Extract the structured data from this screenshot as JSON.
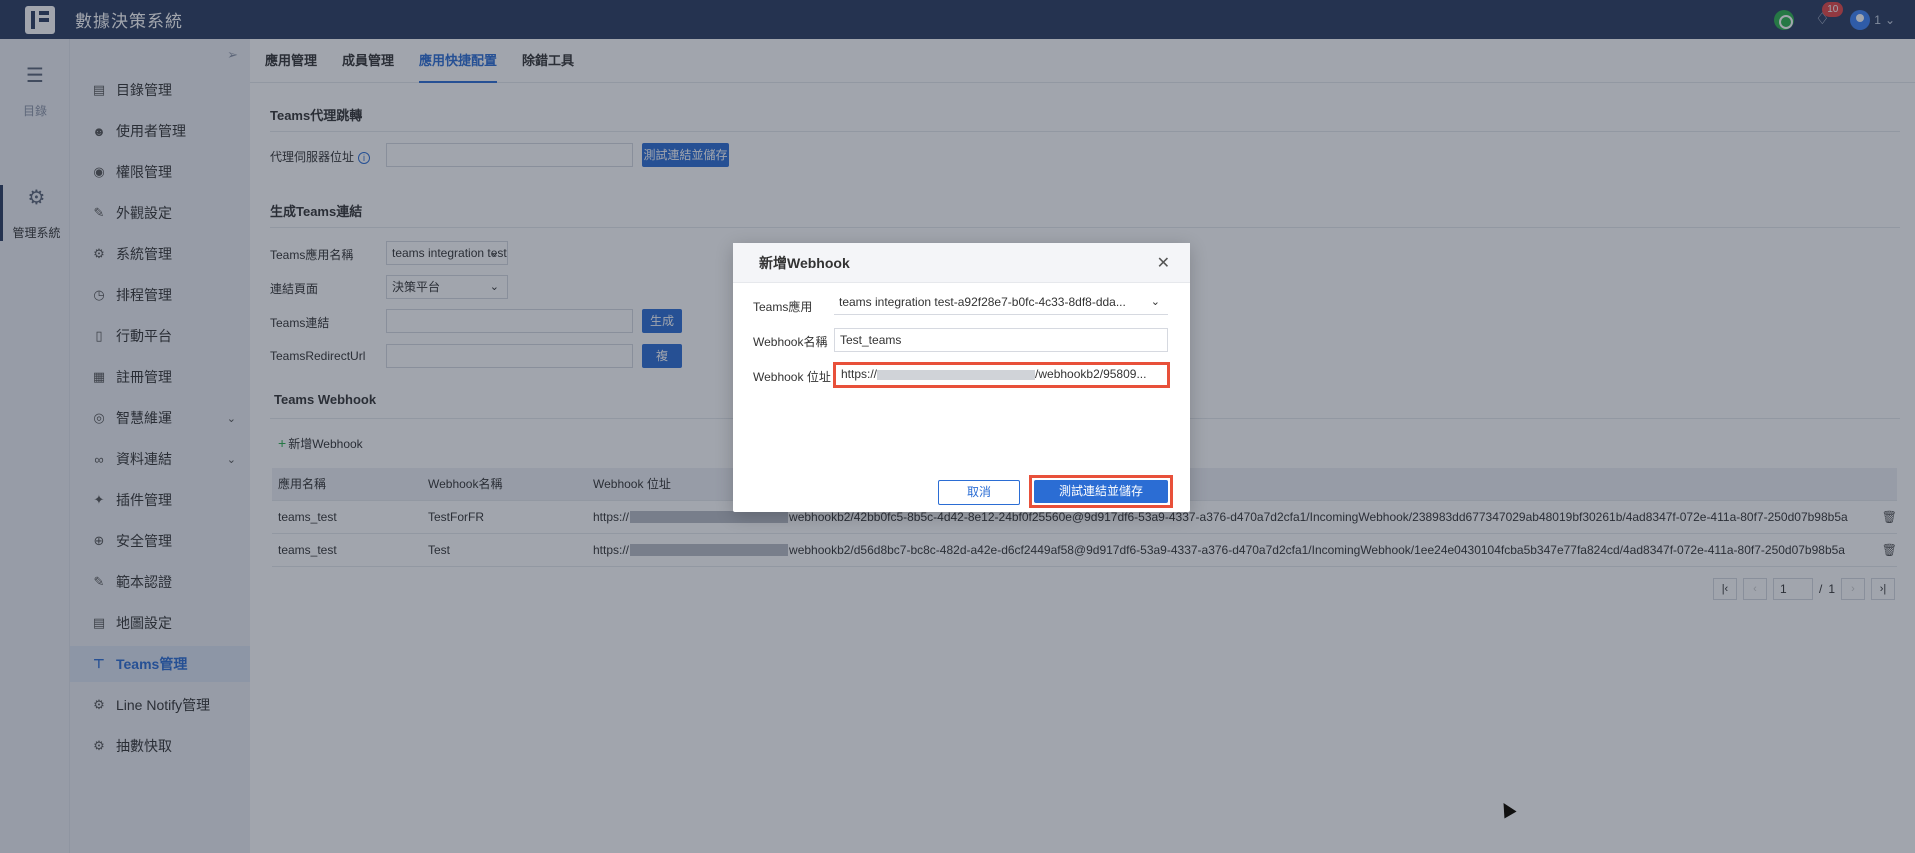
{
  "app": {
    "title": "數據決策系統"
  },
  "header": {
    "notification_count": "10",
    "user_label": "1"
  },
  "rail": {
    "catalog": "目錄",
    "admin": "管理系統"
  },
  "sidebar": {
    "items": [
      {
        "label": "目錄管理",
        "icon": "list-icon"
      },
      {
        "label": "使用者管理",
        "icon": "user-icon"
      },
      {
        "label": "權限管理",
        "icon": "shield-icon"
      },
      {
        "label": "外觀設定",
        "icon": "paint-icon"
      },
      {
        "label": "系統管理",
        "icon": "gear-icon"
      },
      {
        "label": "排程管理",
        "icon": "timer-icon"
      },
      {
        "label": "行動平台",
        "icon": "mobile-icon"
      },
      {
        "label": "註冊管理",
        "icon": "register-icon"
      },
      {
        "label": "智慧維運",
        "icon": "ops-icon"
      },
      {
        "label": "資料連結",
        "icon": "link-icon"
      },
      {
        "label": "插件管理",
        "icon": "plugin-icon"
      },
      {
        "label": "安全管理",
        "icon": "security-icon"
      },
      {
        "label": "範本認證",
        "icon": "template-icon"
      },
      {
        "label": "地圖設定",
        "icon": "map-icon"
      },
      {
        "label": "Teams管理",
        "icon": "teams-icon"
      },
      {
        "label": "Line Notify管理",
        "icon": "gear-icon"
      },
      {
        "label": "抽數快取",
        "icon": "gear-icon"
      }
    ]
  },
  "tabs": [
    "應用管理",
    "成員管理",
    "應用快捷配置",
    "除錯工具"
  ],
  "proxy": {
    "section_title": "Teams代理跳轉",
    "server_label": "代理伺服器位址",
    "test_button": "測試連結並儲存"
  },
  "generate": {
    "section_title": "生成Teams連結",
    "app_name_label": "Teams應用名稱",
    "app_name_value": "teams integration test",
    "link_page_label": "連結頁面",
    "link_page_value": "決策平台",
    "teams_link_label": "Teams連結",
    "redirect_label": "TeamsRedirectUrl",
    "generate_button": "生成",
    "copy_button": "複"
  },
  "webhook": {
    "section_title": "Teams Webhook",
    "add_label": "新增Webhook",
    "columns": [
      "應用名稱",
      "Webhook名稱",
      "Webhook 位址"
    ],
    "rows": [
      {
        "app": "teams_test",
        "name": "TestForFR",
        "url_prefix": "https://",
        "url_suffix": "webhookb2/42bb0fc5-8b5c-4d42-8e12-24bf0f25560e@9d917df6-53a9-4337-a376-d470a7d2cfa1/IncomingWebhook/238983dd677347029ab48019bf30261b/4ad8347f-072e-411a-80f7-250d07b98b5a"
      },
      {
        "app": "teams_test",
        "name": "Test",
        "url_prefix": "https://",
        "url_suffix": "webhookb2/d56d8bc7-bc8c-482d-a42e-d6cf2449af58@9d917df6-53a9-4337-a376-d470a7d2cfa1/IncomingWebhook/1ee24e0430104fcba5b347e77fa824cd/4ad8347f-072e-411a-80f7-250d07b98b5a"
      }
    ]
  },
  "pager": {
    "current": "1",
    "separator": "/",
    "total": "1"
  },
  "modal": {
    "title": "新增Webhook",
    "teams_app_label": "Teams應用",
    "teams_app_value": "teams integration test-a92f28e7-b0fc-4c33-8df8-dda...",
    "name_label": "Webhook名稱",
    "name_value": "Test_teams",
    "url_label": "Webhook 位址",
    "url_prefix": "https://",
    "url_suffix": "/webhookb2/95809...",
    "cancel": "取消",
    "save": "測試連結並儲存"
  },
  "colors": {
    "header_bg": "#2a3b5f",
    "accent": "#2b6dd4",
    "highlight": "#e8503a"
  }
}
